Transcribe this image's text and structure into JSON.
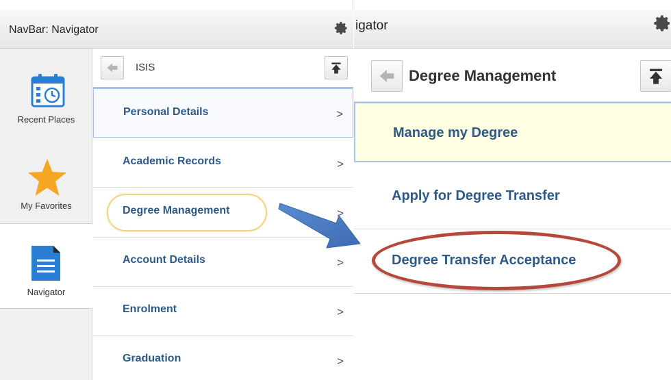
{
  "left": {
    "title": "NavBar: Navigator",
    "sidebar": [
      {
        "label": "Recent Places",
        "icon": "calendar-clock-icon"
      },
      {
        "label": "My Favorites",
        "icon": "star-icon"
      },
      {
        "label": "Navigator",
        "icon": "document-icon"
      }
    ],
    "menu_title": "ISIS",
    "items": [
      {
        "label": "Personal Details"
      },
      {
        "label": "Academic Records"
      },
      {
        "label": "Degree Management"
      },
      {
        "label": "Account Details"
      },
      {
        "label": "Enrolment"
      },
      {
        "label": "Graduation"
      }
    ],
    "chevron": ">"
  },
  "right": {
    "title": "igator",
    "menu_title": "Degree Management",
    "items": [
      {
        "label": "Manage my Degree"
      },
      {
        "label": "Apply for Degree Transfer"
      },
      {
        "label": "Degree Transfer Acceptance"
      }
    ]
  },
  "colors": {
    "link": "#2d5a87",
    "highlight_bg": "#fffde2",
    "selected_border": "#a8c3e8",
    "annotation_oval_left": "#f1d486",
    "annotation_oval_right": "#b5473b",
    "arrow": "#4a78bd",
    "star": "#f5a623",
    "icon_blue": "#2a7fd4"
  }
}
